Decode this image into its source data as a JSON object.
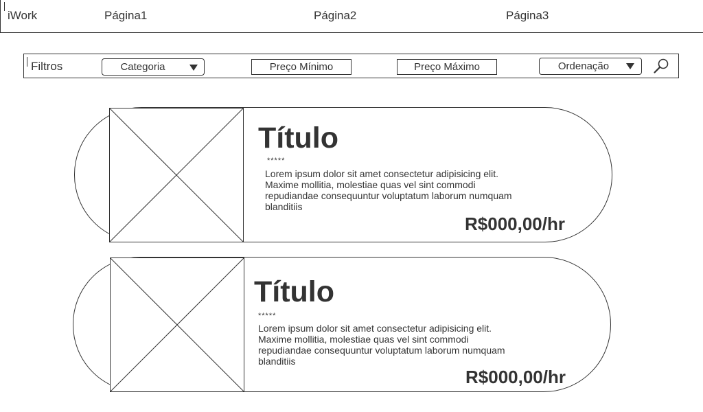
{
  "header": {
    "brand": "iWork",
    "nav": [
      {
        "label": "Página1"
      },
      {
        "label": "Página2"
      },
      {
        "label": "Página3"
      }
    ]
  },
  "filters": {
    "label": "Filtros",
    "category": {
      "value": "Categoria"
    },
    "min_price": {
      "placeholder": "Preço Mínimo"
    },
    "max_price": {
      "placeholder": "Preço Máximo"
    },
    "sort": {
      "value": "Ordenação"
    },
    "search_icon": "search-icon"
  },
  "listings": [
    {
      "title": "Título",
      "rating": "*****",
      "description": "Lorem ipsum dolor sit amet consectetur adipisicing elit. Maxime mollitia, molestiae quas vel sint commodi repudiandae consequuntur voluptatum laborum numquam blanditiis",
      "price": "R$000,00/hr"
    },
    {
      "title": "Título",
      "rating": "*****",
      "description": "Lorem ipsum dolor sit amet consectetur adipisicing elit. Maxime mollitia, molestiae quas vel sint commodi repudiandae consequuntur voluptatum laborum numquam blanditiis",
      "price": "R$000,00/hr"
    }
  ],
  "colors": {
    "stroke": "#333333",
    "background": "#ffffff"
  }
}
